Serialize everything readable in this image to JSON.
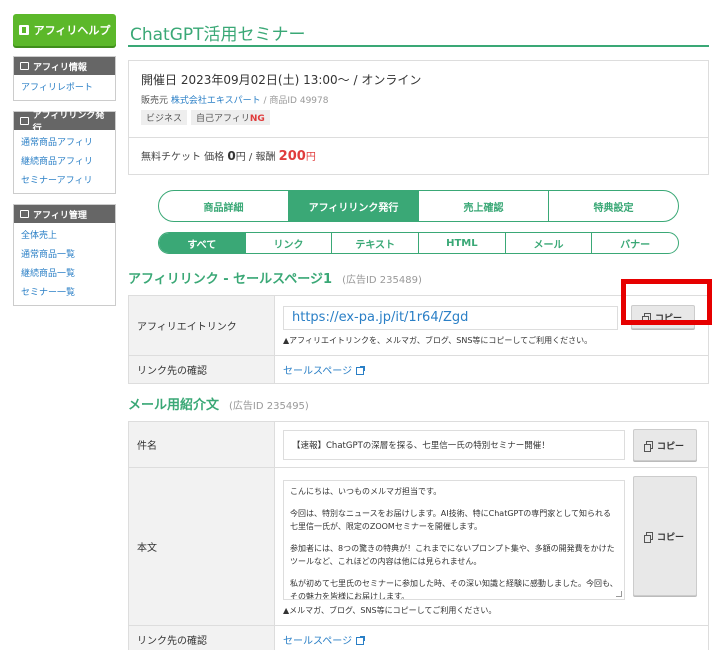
{
  "sidebar": {
    "help_button": "アフィリヘルプ",
    "sections": [
      {
        "title": "アフィリ情報",
        "items": [
          "アフィリレポート"
        ]
      },
      {
        "title": "アフィリリンク発行",
        "items": [
          "通常商品アフィリ",
          "継続商品アフィリ",
          "セミナーアフィリ"
        ]
      },
      {
        "title": "アフィリ管理",
        "items": [
          "全体売上",
          "通常商品一覧",
          "継続商品一覧",
          "セミナー一覧"
        ]
      }
    ]
  },
  "page": {
    "title": "ChatGPT活用セミナー"
  },
  "info": {
    "date": "開催日 2023年09月02日(土) 13:00〜 / オンライン",
    "seller_label": "販売元",
    "seller_name": "株式会社エキスパート",
    "product_id": "/ 商品ID 49978",
    "tags": [
      "ビジネス",
      "自己アフィリ"
    ],
    "tag_ng": "NG",
    "ticket_label": "無料チケット 価格",
    "price": "0",
    "price_unit": "円",
    "reward_label": "/ 報酬",
    "reward": "200",
    "reward_unit": "円"
  },
  "tabs_main": [
    "商品詳細",
    "アフィリリンク発行",
    "売上確認",
    "特典設定"
  ],
  "tabs_main_active": 1,
  "tabs_sub": [
    "すべて",
    "リンク",
    "テキスト",
    "HTML",
    "メール",
    "バナー"
  ],
  "tabs_sub_active": 0,
  "affiliate_section": {
    "heading": "アフィリリンク - セールスページ1",
    "ad_id": "(広告ID 235489)",
    "link_label": "アフィリエイトリンク",
    "url": "https://ex-pa.jp/it/1r64/Zgd",
    "copy_label": "コピー",
    "note": "▲アフィリエイトリンクを、メルマガ、ブログ、SNS等にコピーしてご利用ください。",
    "check_label": "リンク先の確認",
    "check_link": "セールスページ"
  },
  "mail_section": {
    "heading": "メール用紹介文",
    "ad_id": "(広告ID 235495)",
    "subject_label": "件名",
    "subject": "【速報】ChatGPTの深層を探る、七里信一氏の特別セミナー開催！",
    "body_label": "本文",
    "body_paragraphs": [
      "こんにちは、いつものメルマガ担当です。",
      "今回は、特別なニュースをお届けします。AI技術、特にChatGPTの専門家として知られる七里信一氏が、限定のZOOMセミナーを開催します。",
      "参加者には、8つの驚きの特典が！これまでにないプロンプト集や、多額の開発費をかけたツールなど、これほどの内容は他には見られません。",
      "私が初めて七里氏のセミナーに参加した時、その深い知識と経験に感動しました。今回も、その魅力を皆様にお届けします。"
    ],
    "copy_label": "コピー",
    "note": "▲メルマガ、ブログ、SNS等にコピーしてご利用ください。",
    "check_label": "リンク先の確認",
    "check_link": "セールスページ"
  }
}
